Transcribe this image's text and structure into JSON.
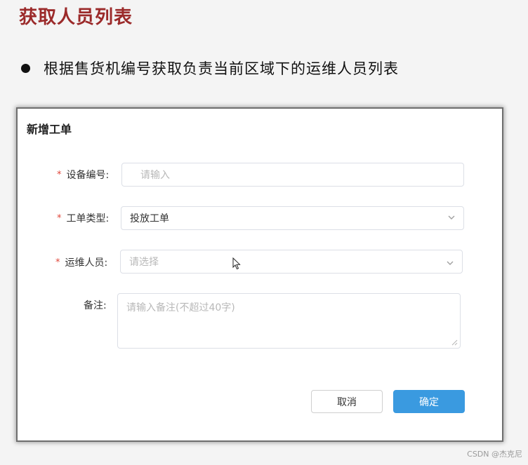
{
  "slide": {
    "title": "获取人员列表",
    "bullet": "根据售货机编号获取负责当前区域下的运维人员列表"
  },
  "dialog": {
    "title": "新增工单",
    "fields": {
      "device_code": {
        "required_mark": "*",
        "label": "设备编号:",
        "placeholder": "请输入"
      },
      "ticket_type": {
        "required_mark": "*",
        "label": "工单类型:",
        "value": "投放工单"
      },
      "staff": {
        "required_mark": "*",
        "label": "运维人员:",
        "placeholder": "请选择"
      },
      "remark": {
        "label": "备注:",
        "placeholder": "请输入备注(不超过40字)"
      }
    },
    "buttons": {
      "cancel": "取消",
      "confirm": "确定"
    }
  },
  "watermark": "CSDN @杰克尼",
  "colors": {
    "title_red": "#9b2a2a",
    "required_star": "#e0463a",
    "primary_button": "#3a9ae0"
  },
  "icons": [
    "chevron-down-icon",
    "textarea-resize-icon",
    "mouse-cursor-icon"
  ]
}
